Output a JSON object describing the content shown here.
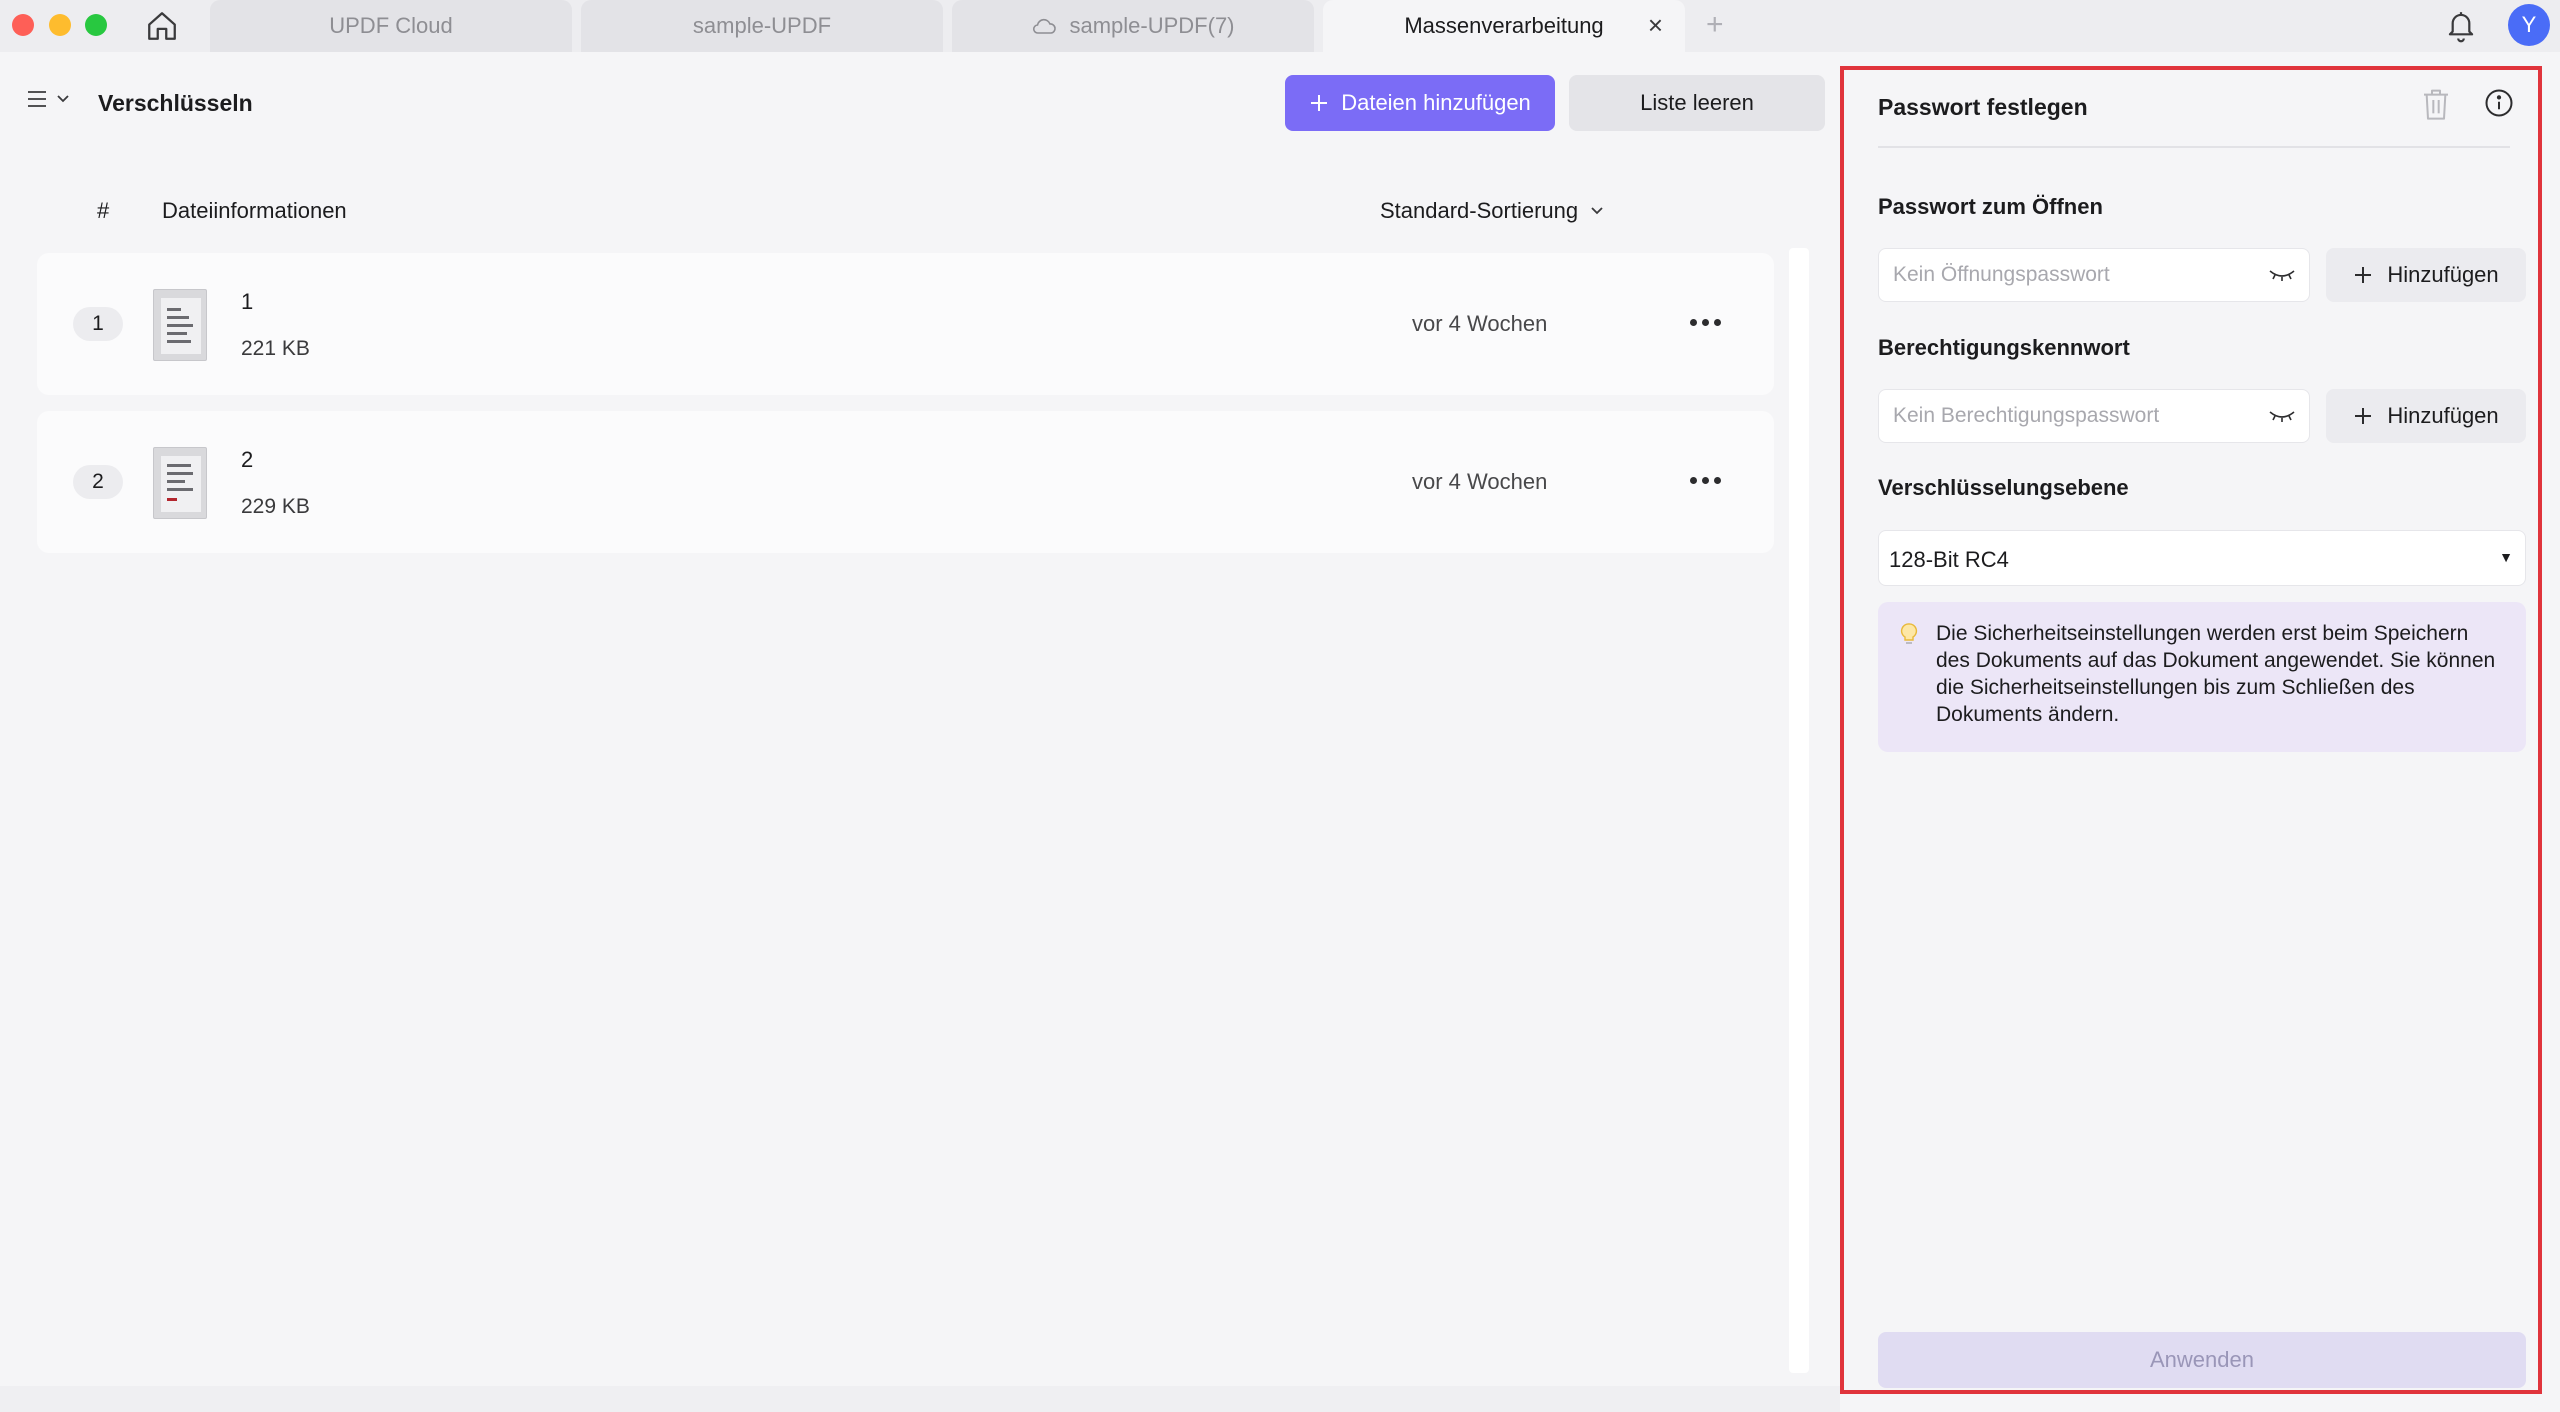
{
  "tabs": [
    {
      "label": "UPDF Cloud",
      "active": false
    },
    {
      "label": "sample-UPDF",
      "active": false
    },
    {
      "label": "sample-UPDF(7)",
      "active": false,
      "icon": "cloud-icon"
    },
    {
      "label": "Massenverarbeitung",
      "active": true
    }
  ],
  "user": {
    "avatar_initial": "Y"
  },
  "toolbar": {
    "title": "Verschlüsseln",
    "add_files_label": "Dateien hinzufügen",
    "clear_list_label": "Liste leeren"
  },
  "list": {
    "col_number": "#",
    "col_info": "Dateiinformationen",
    "sort_label": "Standard-Sortierung",
    "files": [
      {
        "index": "1",
        "name": "1",
        "size": "221 KB",
        "date": "vor 4 Wochen"
      },
      {
        "index": "2",
        "name": "2",
        "size": "229 KB",
        "date": "vor 4 Wochen"
      }
    ]
  },
  "panel": {
    "title": "Passwort festlegen",
    "open_password": {
      "label": "Passwort zum Öffnen",
      "placeholder": "Kein Öffnungspasswort",
      "add_label": "Hinzufügen"
    },
    "permission_password": {
      "label": "Berechtigungskennwort",
      "placeholder": "Kein Berechtigungspasswort",
      "add_label": "Hinzufügen"
    },
    "encryption": {
      "label": "Verschlüsselungsebene",
      "selected": "128-Bit RC4"
    },
    "note": "Die Sicherheitseinstellungen werden erst beim Speichern des Dokuments auf das Dokument angewendet. Sie können die Sicherheitseinstellungen bis zum Schließen des Dokuments ändern.",
    "apply_label": "Anwenden"
  },
  "colors": {
    "accent": "#7b6cf6",
    "highlight_border": "#e0343c",
    "note_background": "#ece6f7"
  }
}
